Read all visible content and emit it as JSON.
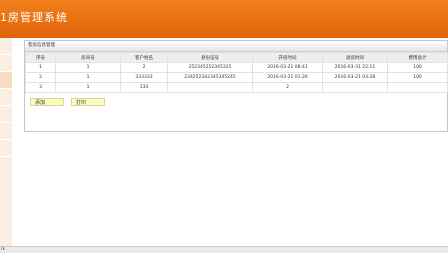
{
  "app": {
    "title": "1房管理系统"
  },
  "panel": {
    "title": "客房信息管理"
  },
  "table": {
    "headers": [
      "序号",
      "房间号",
      "客户姓名",
      "身份证号",
      "开房时间",
      "退房时间",
      "费用总计"
    ],
    "rows": [
      [
        "1",
        "1",
        "2",
        "252345252345325",
        "2016-03-21 08:41",
        "2016-03-31 22:11",
        "100"
      ],
      [
        "2",
        "1",
        "333333",
        "234252342345345245",
        "2016-03-21 01:26",
        "2016-03-21 03:28",
        "100"
      ],
      [
        "3",
        "1",
        "333",
        "",
        "2",
        "",
        ""
      ]
    ]
  },
  "buttons": {
    "add": "添加",
    "print": "打印"
  },
  "footer": {
    "text": "rk"
  }
}
